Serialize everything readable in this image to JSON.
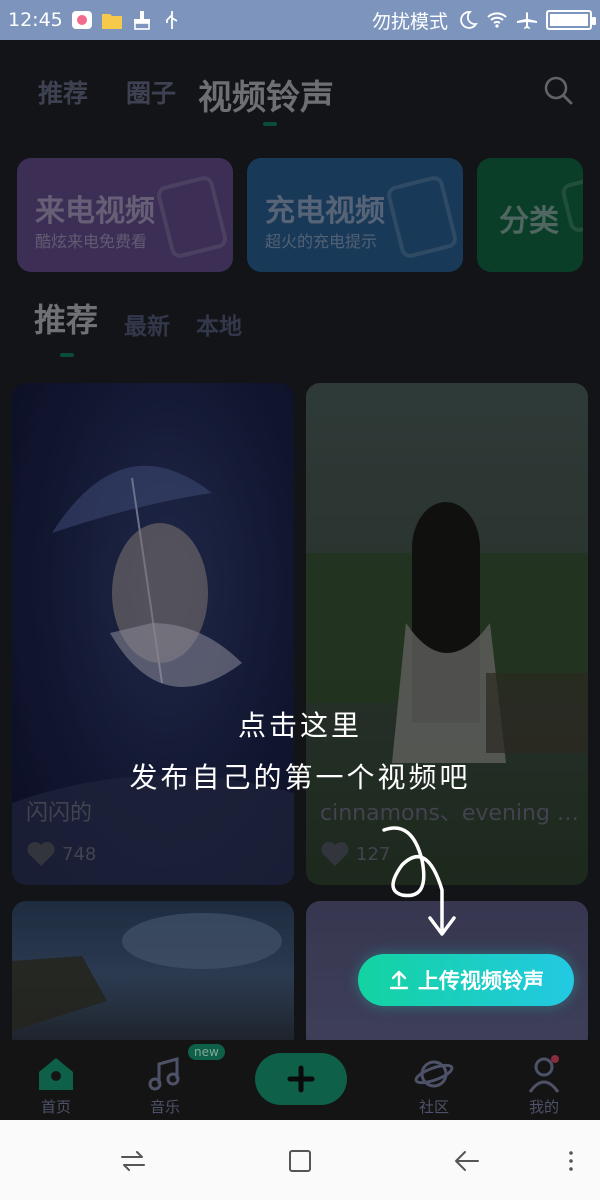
{
  "status_bar": {
    "time": "12:45",
    "dnd_text": "勿扰模式",
    "battery_level": 1.0
  },
  "top_nav": {
    "tabs": [
      {
        "label": "推荐"
      },
      {
        "label": "圈子"
      },
      {
        "label": "视频铃声"
      }
    ]
  },
  "categories": [
    {
      "title": "来电视频",
      "subtitle": "酷炫来电免费看",
      "color": "#7a4fb4"
    },
    {
      "title": "充电视频",
      "subtitle": "超火的充电提示",
      "color": "#2c6ca8"
    },
    {
      "title": "分类",
      "subtitle": "",
      "color": "#0e6e48"
    }
  ],
  "sub_tabs": [
    {
      "label": "推荐"
    },
    {
      "label": "最新"
    },
    {
      "label": "本地"
    }
  ],
  "videos": [
    {
      "title": "闪闪的",
      "likes": "748"
    },
    {
      "title": "cinnamons、evening ci...",
      "likes": "127"
    },
    {
      "title": "",
      "likes": ""
    },
    {
      "title": "",
      "likes": ""
    }
  ],
  "guide": {
    "line1": "点击这里",
    "line2": "发布自己的第一个视频吧",
    "upload_label": "上传视频铃声"
  },
  "bottom_nav": {
    "items": [
      {
        "label": "首页"
      },
      {
        "label": "音乐"
      },
      {
        "label": "社区"
      },
      {
        "label": "我的"
      }
    ],
    "new_badge": "new"
  },
  "colors": {
    "accent": "#13d3a0",
    "accent2": "#23c9e3",
    "status_bar": "#7d95bd"
  }
}
